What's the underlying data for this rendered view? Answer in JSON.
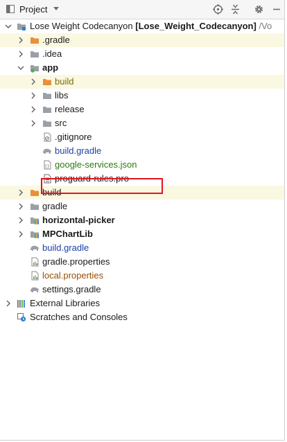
{
  "panel": {
    "title": "Project",
    "toolbar": {
      "locate_icon": "crosshair-icon",
      "collapse_icon": "collapse-all-icon",
      "settings_icon": "gear-icon",
      "hide_icon": "minimize-icon"
    }
  },
  "tree": {
    "root": {
      "name": "Lose Weight Codecanyon",
      "module": "[Lose_Weight_Codecanyon]",
      "path": "/Vo"
    },
    "items": [
      {
        "label": ".gradle"
      },
      {
        "label": ".idea"
      },
      {
        "label": "app"
      },
      {
        "label": "build"
      },
      {
        "label": "libs"
      },
      {
        "label": "release"
      },
      {
        "label": "src"
      },
      {
        "label": ".gitignore"
      },
      {
        "label": "build.gradle"
      },
      {
        "label": "google-services.json"
      },
      {
        "label": "proguard-rules.pro"
      },
      {
        "label": "build"
      },
      {
        "label": "gradle"
      },
      {
        "label": "horizontal-picker"
      },
      {
        "label": "MPChartLib"
      },
      {
        "label": "build.gradle"
      },
      {
        "label": "gradle.properties"
      },
      {
        "label": "local.properties"
      },
      {
        "label": "settings.gradle"
      },
      {
        "label": "External Libraries"
      },
      {
        "label": "Scratches and Consoles"
      }
    ]
  },
  "colors": {
    "highlight_row": "#fbf8e2",
    "annotation_box": "#e0141e",
    "folder_orange": "#e8903a",
    "folder_grey": "#9aa0a6",
    "link_blue": "#1c3fa8",
    "json_green": "#2b7a0b",
    "properties_brown": "#9a4d00"
  }
}
